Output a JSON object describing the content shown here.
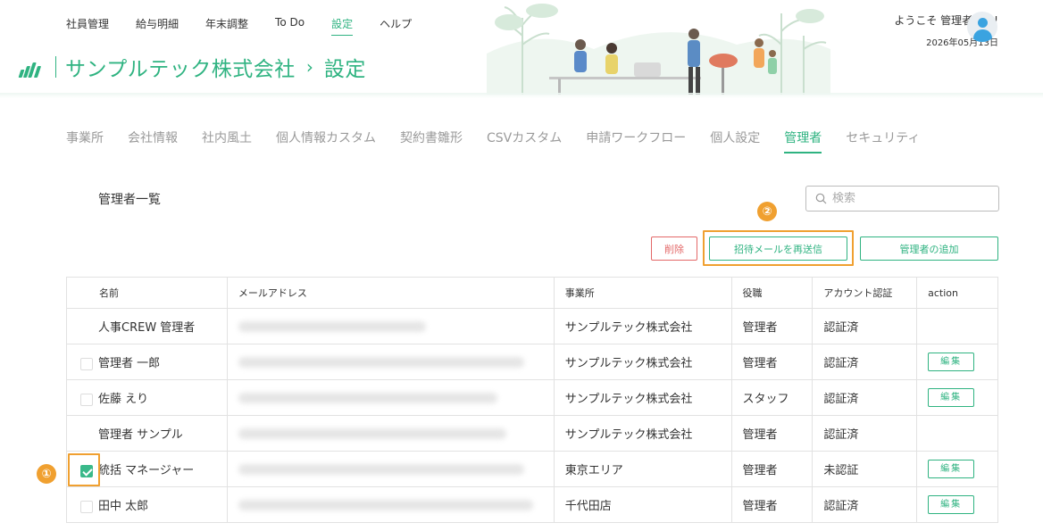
{
  "topnav": {
    "items": [
      "社員管理",
      "給与明細",
      "年末調整",
      "To Do",
      "設定",
      "ヘルプ"
    ],
    "active": "設定"
  },
  "brand": {
    "company": "サンプルテック株式会社",
    "arrow": "›",
    "page": "設定"
  },
  "user": {
    "welcome": "ようこそ 管理者さん!",
    "date": "2026年05月13日"
  },
  "subtabs": {
    "items": [
      "事業所",
      "会社情報",
      "社内風土",
      "個人情報カスタム",
      "契約書雛形",
      "CSVカスタム",
      "申請ワークフロー",
      "個人設定",
      "管理者",
      "セキュリティ"
    ],
    "active": "管理者"
  },
  "section_title": "管理者一覧",
  "search": {
    "placeholder": "検索",
    "value": ""
  },
  "buttons": {
    "delete": "削除",
    "resend": "招待メールを再送信",
    "add": "管理者の追加"
  },
  "annotations": {
    "one": "①",
    "two": "②"
  },
  "table": {
    "headers": [
      "名前",
      "メールアドレス",
      "事業所",
      "役職",
      "アカウント認証",
      "action"
    ],
    "rows": [
      {
        "name": "人事CREW 管理者",
        "office": "サンプルテック株式会社",
        "role": "管理者",
        "auth": "認証済",
        "action": ""
      },
      {
        "name": "管理者 一郎",
        "office": "サンプルテック株式会社",
        "role": "管理者",
        "auth": "認証済",
        "action": "編集"
      },
      {
        "name": "佐藤 えり",
        "office": "サンプルテック株式会社",
        "role": "スタッフ",
        "auth": "認証済",
        "action": "編集"
      },
      {
        "name": "管理者 サンプル",
        "office": "サンプルテック株式会社",
        "role": "管理者",
        "auth": "認証済",
        "action": ""
      },
      {
        "name": "統括 マネージャー",
        "office": "東京エリア",
        "role": "管理者",
        "auth": "未認証",
        "action": "編集"
      },
      {
        "name": "田中 太郎",
        "office": "千代田店",
        "role": "管理者",
        "auth": "認証済",
        "action": "編集"
      }
    ]
  },
  "colors": {
    "accent": "#2fb381",
    "danger": "#e36868",
    "highlight": "#f0a030"
  }
}
